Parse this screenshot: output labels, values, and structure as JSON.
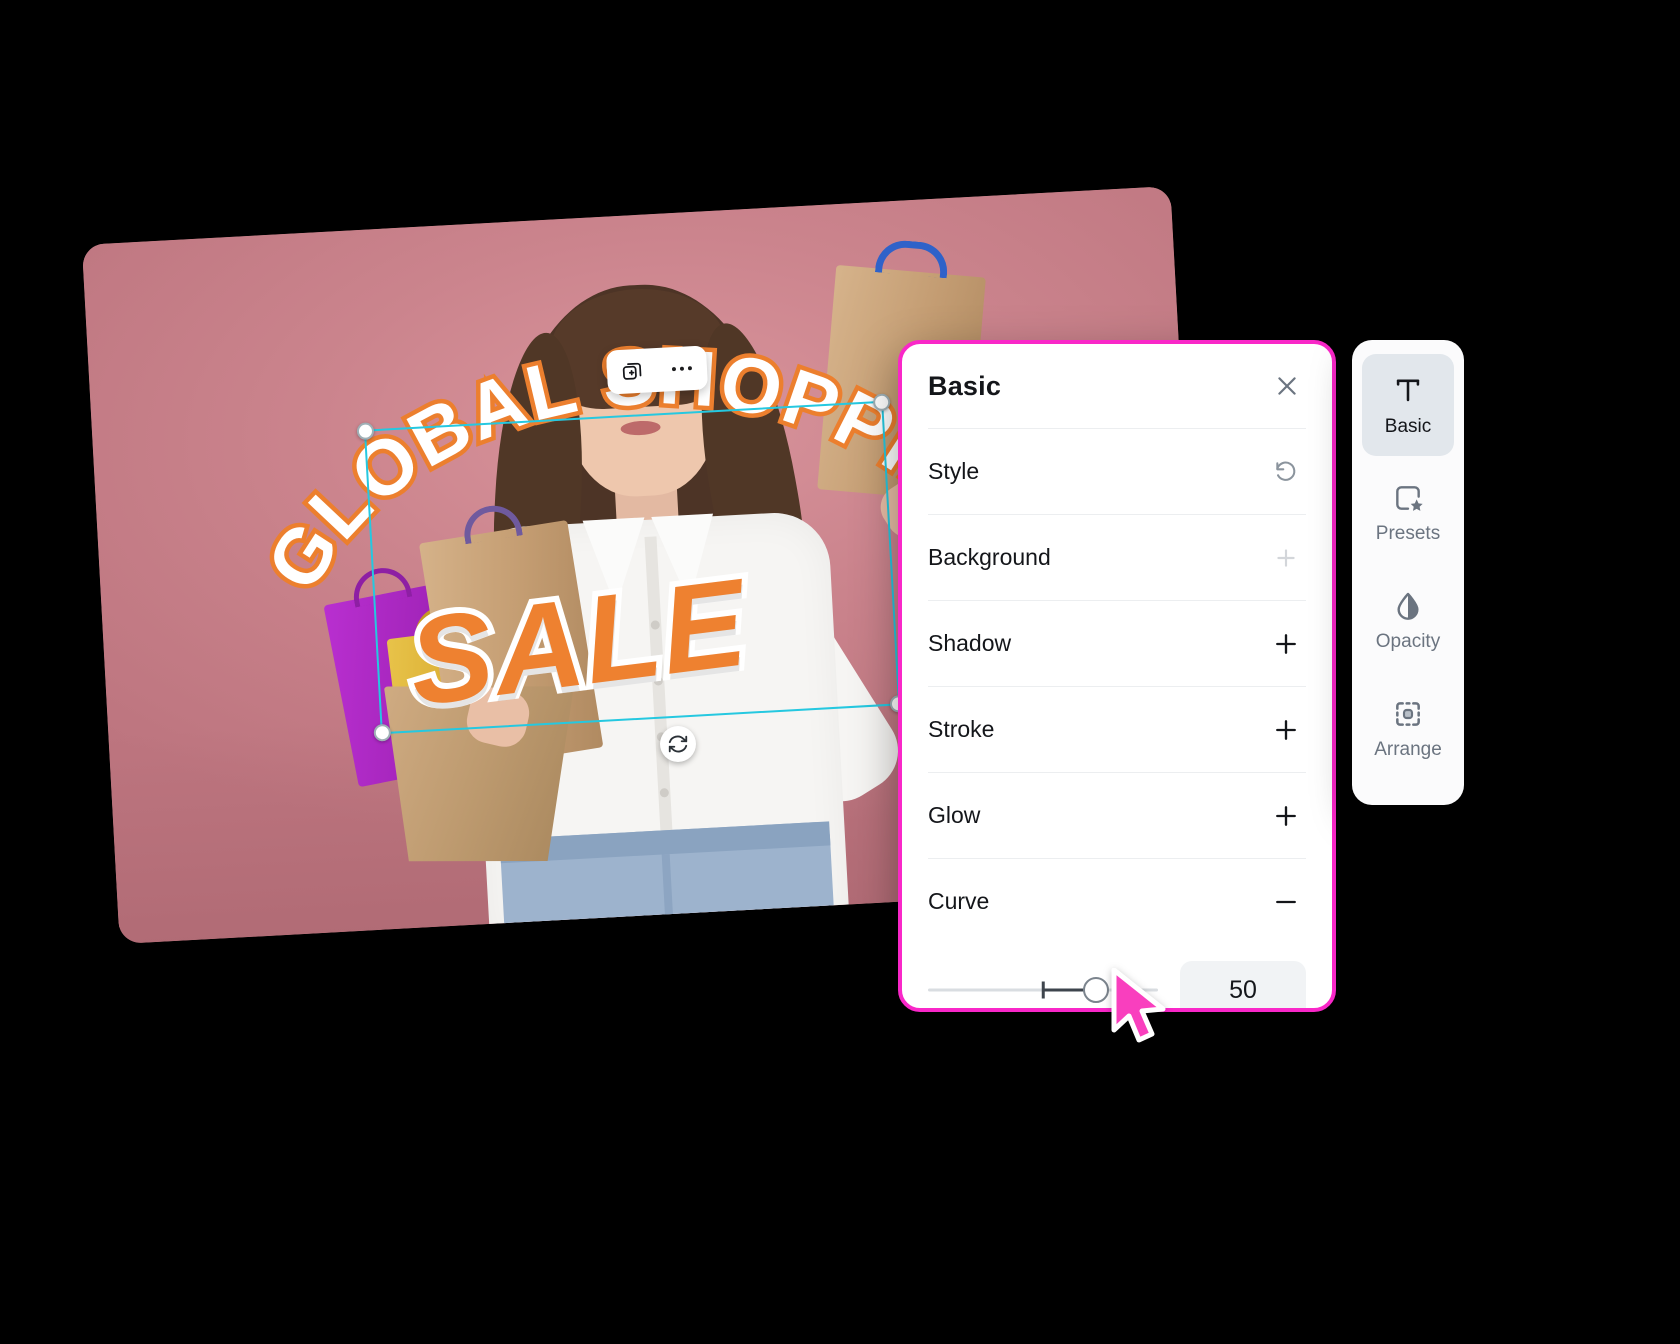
{
  "artwork": {
    "arc_text": "GLOBAL SHOPPING",
    "headline": "SALE",
    "background_color": "#c9808a",
    "text_fill": "#ffffff",
    "text_stroke": "#ec7f2e",
    "headline_fill": "#ee8130"
  },
  "mini_toolbar": {
    "duplicate_icon": "duplicate-add-icon",
    "more_icon": "more-options-icon"
  },
  "selection": {
    "rotate_icon": "rotate-icon",
    "outline_color": "#25c8e0"
  },
  "panel": {
    "title": "Basic",
    "close_icon": "close-icon",
    "border_color": "#f927c8",
    "rows": [
      {
        "label": "Style",
        "action_icon": "reset-icon",
        "action_symbol": "reset"
      },
      {
        "label": "Background",
        "action_icon": "plus-icon",
        "action_symbol": "+"
      },
      {
        "label": "Shadow",
        "action_icon": "plus-icon",
        "action_symbol": "+"
      },
      {
        "label": "Stroke",
        "action_icon": "plus-icon",
        "action_symbol": "+"
      },
      {
        "label": "Glow",
        "action_icon": "plus-icon",
        "action_symbol": "+"
      },
      {
        "label": "Curve",
        "action_icon": "minus-icon",
        "action_symbol": "−"
      }
    ],
    "curve_slider": {
      "value": "50",
      "min": 0,
      "max": 100,
      "knob_position_pct": 73,
      "center_tick_pct": 50
    }
  },
  "right_toolbar": {
    "items": [
      {
        "label": "Basic",
        "icon": "text-type-icon",
        "active": true
      },
      {
        "label": "Presets",
        "icon": "preset-star-icon",
        "active": false
      },
      {
        "label": "Opacity",
        "icon": "opacity-drop-icon",
        "active": false
      },
      {
        "label": "Arrange",
        "icon": "arrange-icon",
        "active": false
      }
    ]
  },
  "cursor": {
    "icon": "mouse-pointer-icon",
    "color": "#f93fbe"
  }
}
